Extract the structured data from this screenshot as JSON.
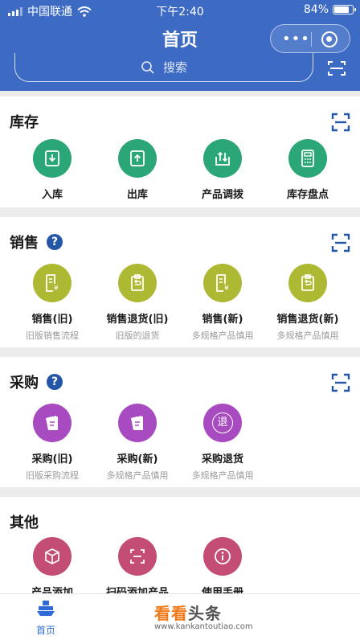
{
  "status_bar": {
    "carrier": "中国联通",
    "time": "下午2:40",
    "battery": "84%",
    "battery_level": 0.84
  },
  "header": {
    "title": "首页"
  },
  "search": {
    "placeholder": "搜索"
  },
  "sections": {
    "inventory": {
      "title": "库存",
      "items": [
        {
          "label": "入库",
          "icon": "import-icon"
        },
        {
          "label": "出库",
          "icon": "export-icon"
        },
        {
          "label": "产品调拨",
          "icon": "transfer-icon"
        },
        {
          "label": "库存盘点",
          "icon": "calculator-icon"
        }
      ]
    },
    "sales": {
      "title": "销售",
      "items": [
        {
          "label": "销售(旧)",
          "sub": "旧版销售流程",
          "icon": "sales-doc-icon"
        },
        {
          "label": "销售退货(旧)",
          "sub": "旧版的退货",
          "icon": "sales-return-icon"
        },
        {
          "label": "销售(新)",
          "sub": "多规格产品慎用",
          "icon": "sales-doc-icon"
        },
        {
          "label": "销售退货(新)",
          "sub": "多规格产品慎用",
          "icon": "sales-return-icon"
        }
      ]
    },
    "purchase": {
      "title": "采购",
      "items": [
        {
          "label": "采购(旧)",
          "sub": "旧版采购流程",
          "icon": "purchase-doc-icon"
        },
        {
          "label": "采购(新)",
          "sub": "多规格产品慎用",
          "icon": "purchase-doc-icon"
        },
        {
          "label": "采购退货",
          "sub": "多规格产品慎用",
          "icon": "return-char-icon",
          "glyph": "退"
        }
      ]
    },
    "other": {
      "title": "其他",
      "items": [
        {
          "label": "产品添加",
          "icon": "box-icon"
        },
        {
          "label": "扫码添加产品",
          "icon": "scan-add-icon"
        },
        {
          "label": "使用手册",
          "icon": "info-icon"
        }
      ]
    }
  },
  "tabbar": {
    "home_label": "首页"
  },
  "watermark": {
    "text_orange": "看看",
    "text_gray": "头条",
    "url": "www.kankantoutiao.com"
  },
  "colors": {
    "header_blue": "#3d6bc4",
    "inventory": "#2ba676",
    "sales": "#adb933",
    "purchase": "#a84bc0",
    "other": "#c34d74",
    "help": "#2456a8"
  }
}
